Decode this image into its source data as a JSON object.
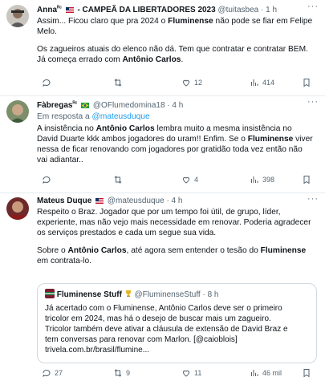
{
  "tweets": [
    {
      "name": "Anna",
      "superscript": "ᴿᶜ",
      "name_suffix": "- CAMPEÃ DA LIBERTADORES 2023",
      "handle": "@tuitasbea",
      "time": "· 1 h",
      "lines": [
        [
          "Assim... Ficou claro que pra 2024 o ",
          "Fluminense",
          " não pode se fiar em Felipe"
        ],
        [
          "Melo."
        ],
        [
          "Os zagueiros atuais do elenco não dá. Tem que contratar e contratar BEM."
        ],
        [
          "Já começa errado com ",
          "Antônio Carlos",
          "."
        ]
      ],
      "actions": {
        "replies": "",
        "retweets": "",
        "likes": "12",
        "views": "414"
      }
    },
    {
      "name": "Fàbregas",
      "superscript": "ᴿᶜ",
      "handle": "@OFlumedomina18",
      "time": "· 4 h",
      "reply_prefix": "Em resposta a",
      "reply_to": "@mateusduque",
      "lines": [
        [
          "A insistência no ",
          "Antônio Carlos",
          " lembra muito a mesma insistência no"
        ],
        [
          "David Duarte kkk ambos jogadores do uram!! Enfim. Se o ",
          "Fluminense",
          " viver"
        ],
        [
          "nessa de ficar renovando com jogadores por gratidão toda vez então não"
        ],
        [
          "vai adiantar.."
        ]
      ],
      "actions": {
        "replies": "",
        "retweets": "",
        "likes": "4",
        "views": "398"
      }
    },
    {
      "name": "Mateus Duque",
      "handle": "@mateusduque",
      "time": "· 4 h",
      "lines": [
        [
          "Respeito o Braz. Jogador que por um tempo foi útil, de grupo, líder,"
        ],
        [
          "experiente, mas não vejo mais necessidade em renovar. Poderia agradecer"
        ],
        [
          "os serviços prestados e cada um segue sua vida."
        ],
        [
          "Sobre o ",
          "Antônio Carlos",
          ", até agora sem entender o tesão do ",
          "Fluminense"
        ],
        [
          "em contrata-lo."
        ]
      ],
      "quote": {
        "name": "Fluminense Stuff",
        "handle": "@FluminenseStuff",
        "time": "· 8 h",
        "lines": [
          "Já acertado com o Fluminense, Antônio Carlos deve ser o primeiro",
          "tricolor em 2024, mas há o desejo de buscar mais um zagueiro.",
          "Tricolor também deve ativar a cláusula de extensão de David Braz e",
          "tem conversas para renovar com Marlon. [@caioblois]",
          "trivela.com.br/brasil/flumine..."
        ]
      },
      "actions": {
        "replies": "27",
        "retweets": "9",
        "likes": "11",
        "views": "46 mil"
      }
    }
  ],
  "more_label": "···",
  "colors": {
    "accent": "#1d9bf0",
    "muted": "#536471",
    "divider": "#e6ecf0"
  }
}
